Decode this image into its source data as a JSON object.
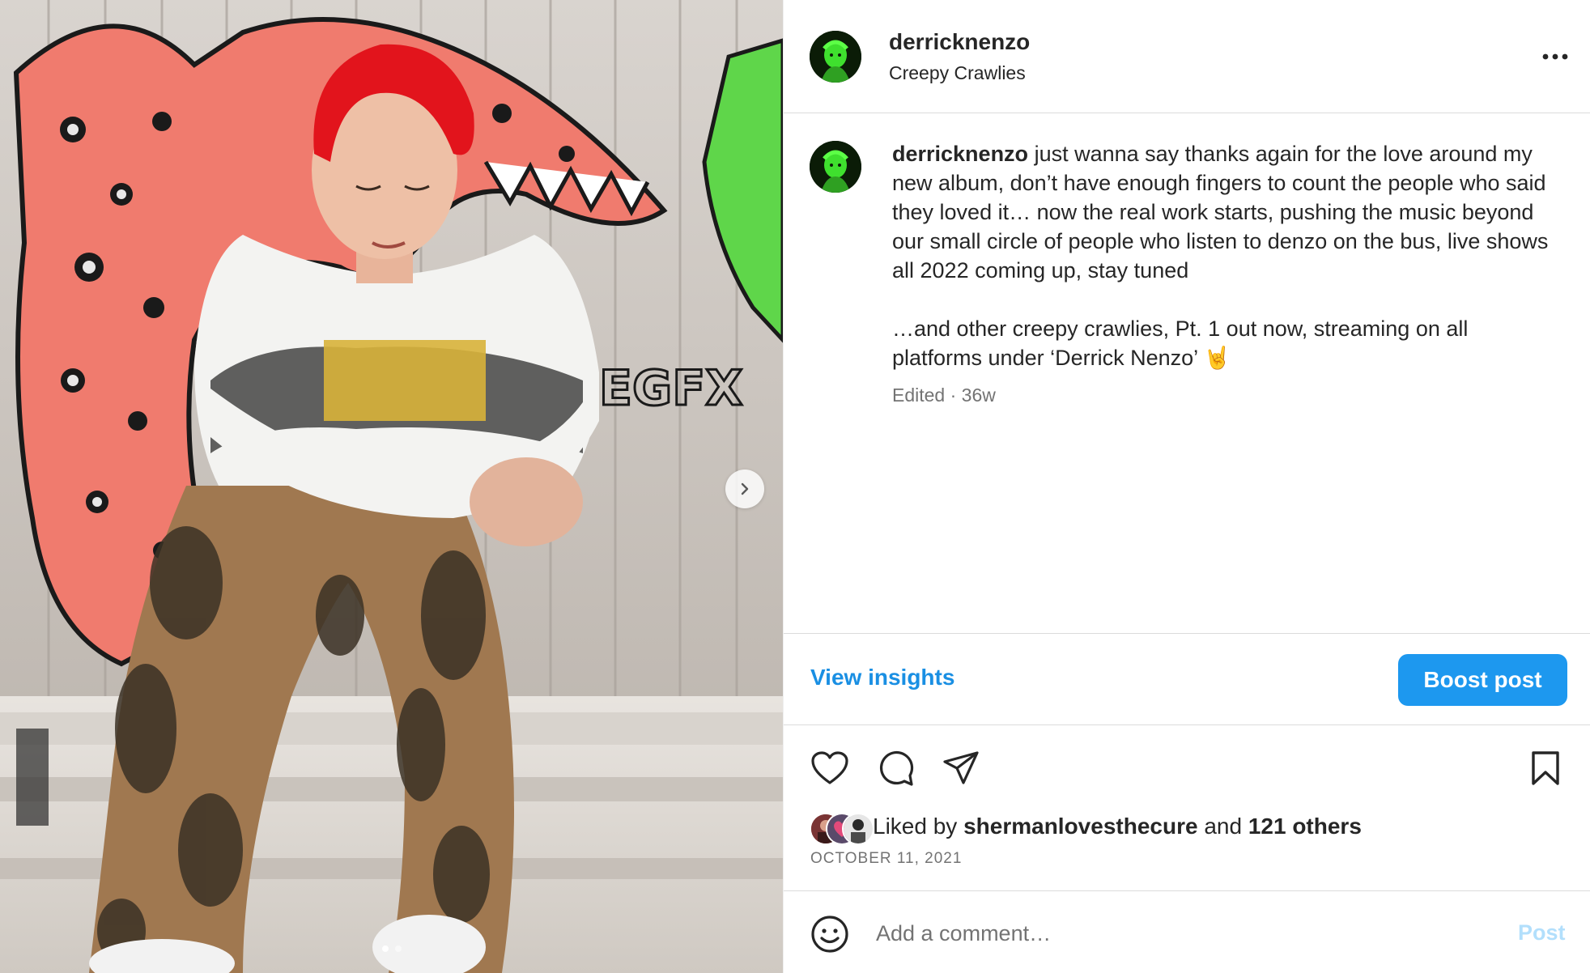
{
  "media": {
    "next_icon": "chevron-right-icon",
    "carousel_position": 1,
    "carousel_count": 2
  },
  "header": {
    "username": "derricknenzo",
    "subtitle": "Creepy Crawlies",
    "more_icon": "more-horizontal-icon"
  },
  "caption": {
    "username": "derricknenzo",
    "text": " just wanna say thanks again for the love around my new album, don’t have enough fingers to count the people who said they loved it… now the real work starts, pushing the music beyond our small circle of people who listen to denzo on the bus, live shows all 2022 coming up, stay tuned\n\n…and other creepy crawlies, Pt. 1 out now, streaming on all platforms under ‘Derrick Nenzo’ 🤘",
    "meta": "Edited · 36w"
  },
  "insights": {
    "view_label": "View insights",
    "boost_label": "Boost post"
  },
  "actions": {
    "like_icon": "heart-icon",
    "comment_icon": "comment-icon",
    "share_icon": "send-icon",
    "save_icon": "bookmark-icon"
  },
  "likes": {
    "prefix": "Liked by ",
    "user": "shermanlovesthecure",
    "middle": " and ",
    "others": "121 others"
  },
  "date": "OCTOBER 11, 2021",
  "comment": {
    "emoji_icon": "emoji-icon",
    "placeholder": "Add a comment…",
    "post_label": "Post"
  },
  "colors": {
    "link_blue": "#1a8fe3",
    "boost_blue": "#1d98ef",
    "post_disabled": "#b2dffc",
    "muted": "#737373"
  }
}
